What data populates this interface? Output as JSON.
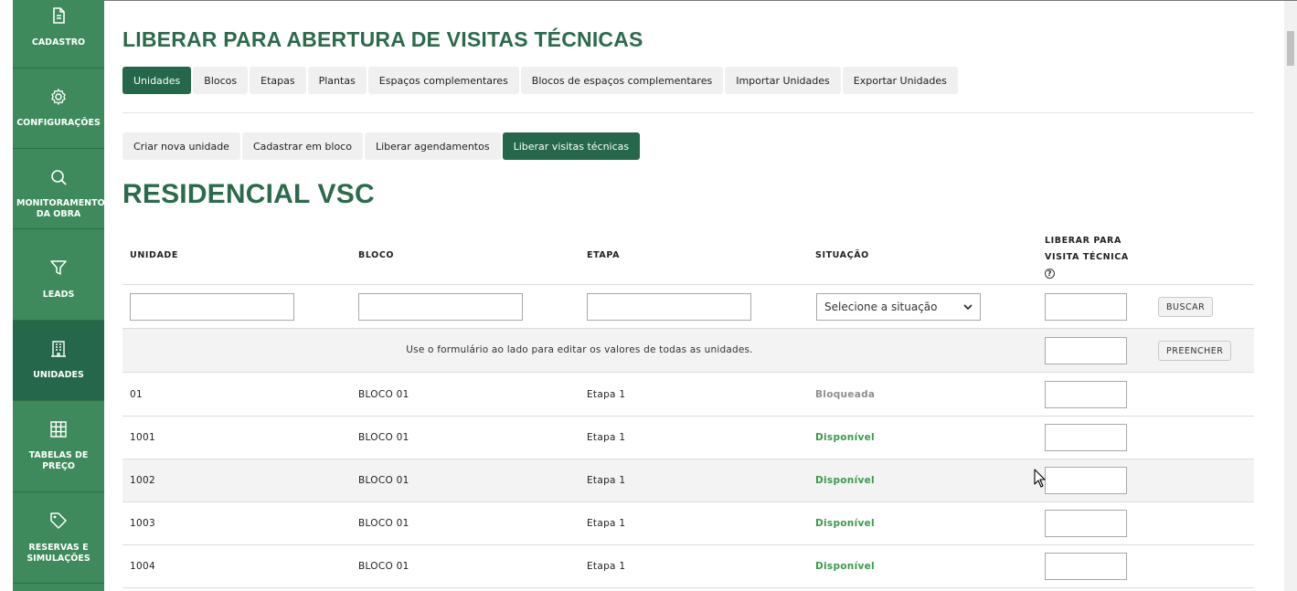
{
  "colors": {
    "sidebar": "#3e8a5c",
    "sidebar_active": "#24674a",
    "accent": "#2b6b4c",
    "available": "#3b9a4d",
    "blocked": "#8f8f8f"
  },
  "sidebar": {
    "items": [
      {
        "icon": "document-icon",
        "label": "CADASTRO"
      },
      {
        "icon": "gear-icon",
        "label": "CONFIGURAÇÕES"
      },
      {
        "icon": "search-icon",
        "label": "MONITORAMENTO DA OBRA"
      },
      {
        "icon": "filter-icon",
        "label": "LEADS"
      },
      {
        "icon": "building-icon",
        "label": "UNIDADES",
        "active": true
      },
      {
        "icon": "grid-icon",
        "label": "TABELAS DE PREÇO"
      },
      {
        "icon": "tag-icon",
        "label": "RESERVAS E SIMULAÇÕES"
      }
    ]
  },
  "page_title": "LIBERAR PARA ABERTURA DE VISITAS TÉCNICAS",
  "tabs": [
    "Unidades",
    "Blocos",
    "Etapas",
    "Plantas",
    "Espaços complementares",
    "Blocos de espaços complementares",
    "Importar Unidades",
    "Exportar Unidades"
  ],
  "active_tab": "Unidades",
  "subtabs": [
    "Criar nova unidade",
    "Cadastrar em bloco",
    "Liberar agendamentos",
    "Liberar visitas técnicas"
  ],
  "active_subtab": "Liberar visitas técnicas",
  "heading": "RESIDENCIAL VSC",
  "table": {
    "headers": [
      "UNIDADE",
      "BLOCO",
      "ETAPA",
      "SITUAÇÃO",
      "LIBERAR PARA VISITA TÉCNICA"
    ],
    "help_icon": "?",
    "filter": {
      "situacao_placeholder": "Selecione a situação",
      "unidade": "",
      "bloco": "",
      "etapa": "",
      "liberar": ""
    },
    "search_button": "BUSCAR",
    "bulk_note": "Use o formulário ao lado para editar os valores de todas as unidades.",
    "fill_button": "PREENCHER",
    "rows": [
      {
        "unidade": "01",
        "bloco": "BLOCO 01",
        "etapa": "Etapa 1",
        "situacao": "Bloqueada",
        "status": "blocked"
      },
      {
        "unidade": "1001",
        "bloco": "BLOCO 01",
        "etapa": "Etapa 1",
        "situacao": "Disponível",
        "status": "available"
      },
      {
        "unidade": "1002",
        "bloco": "BLOCO 01",
        "etapa": "Etapa 1",
        "situacao": "Disponível",
        "status": "available"
      },
      {
        "unidade": "1003",
        "bloco": "BLOCO 01",
        "etapa": "Etapa 1",
        "situacao": "Disponível",
        "status": "available"
      },
      {
        "unidade": "1004",
        "bloco": "BLOCO 01",
        "etapa": "Etapa 1",
        "situacao": "Disponível",
        "status": "available"
      }
    ]
  }
}
